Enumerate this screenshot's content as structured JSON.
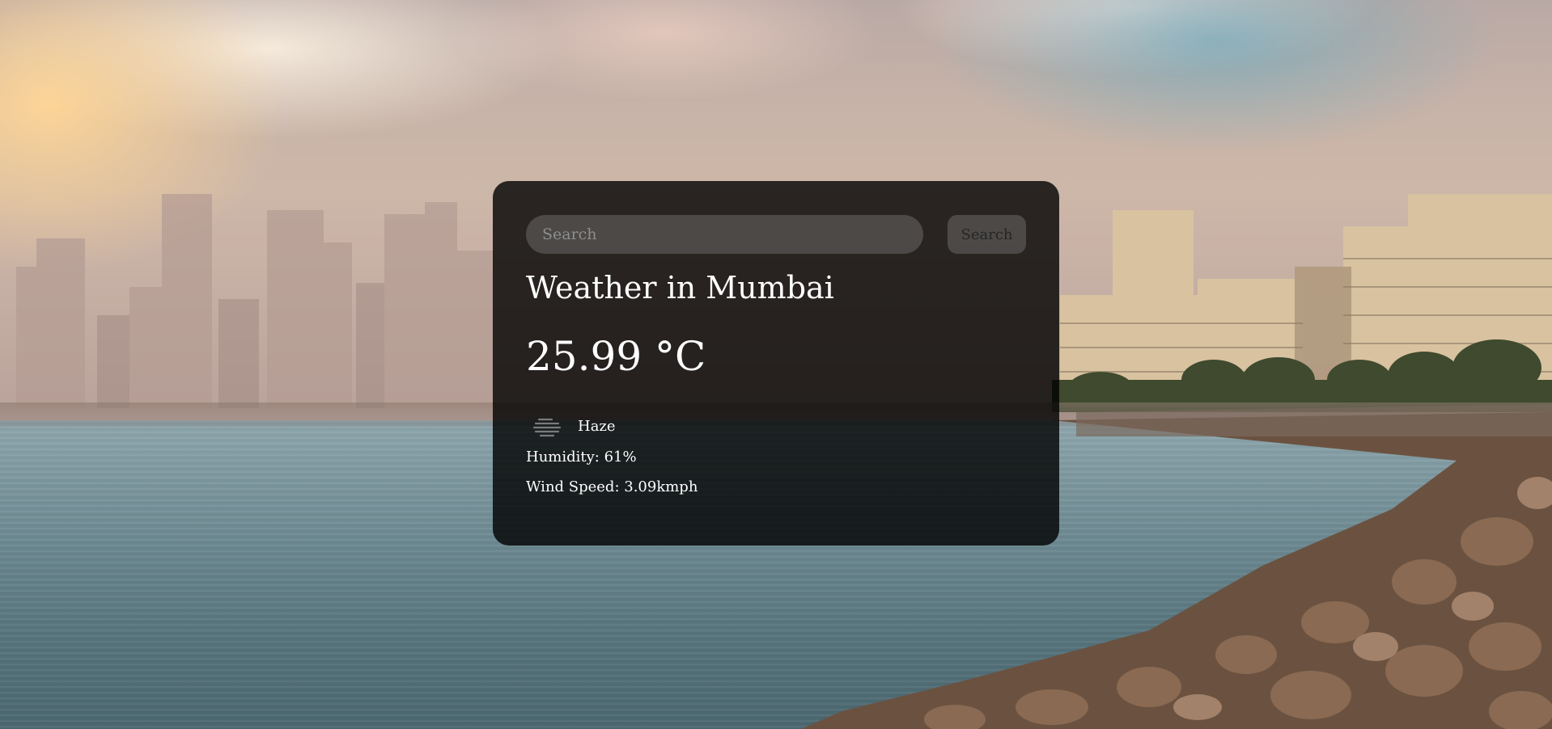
{
  "search": {
    "placeholder": "Search",
    "button_label": "Search"
  },
  "weather": {
    "city_title": "Weather in Mumbai",
    "temperature": "25.99 °C",
    "icon": "haze-icon",
    "description": "Haze",
    "humidity": "Humidity: 61%",
    "wind_speed": "Wind Speed: 3.09kmph"
  },
  "colors": {
    "card_background": "#000000cc",
    "input_background": "#7c7c7c6e",
    "text": "#ffffff"
  }
}
